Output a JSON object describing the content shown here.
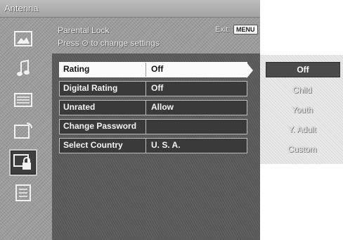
{
  "topbar": {
    "title": "Antenna"
  },
  "header": {
    "title": "Parental Lock",
    "hint": "Press ⊙ to change settings",
    "exit_label": "Exit:",
    "menu_button": "MENU"
  },
  "sidebar": {
    "items": [
      {
        "icon": "picture-icon"
      },
      {
        "icon": "sound-icon"
      },
      {
        "icon": "channel-icon"
      },
      {
        "icon": "timer-icon"
      },
      {
        "icon": "parental-lock-icon",
        "selected": true
      },
      {
        "icon": "setup-icon"
      }
    ]
  },
  "menu": {
    "rows": [
      {
        "label": "Rating",
        "value": "Off"
      },
      {
        "label": "Digital Rating",
        "value": "Off"
      },
      {
        "label": "Unrated",
        "value": "Allow"
      },
      {
        "label": "Change Password",
        "value": ""
      },
      {
        "label": "Select Country",
        "value": "U. S. A."
      }
    ]
  },
  "options": {
    "items": [
      "Off",
      "Child",
      "Youth",
      "Y. Adult",
      "Custom"
    ],
    "selected": "Off"
  }
}
